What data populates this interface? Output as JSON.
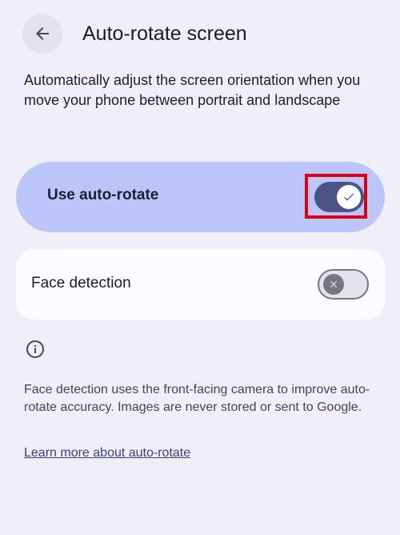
{
  "app_bar": {
    "back_icon": "arrow-back-icon",
    "title": "Auto-rotate screen"
  },
  "description": "Automatically adjust the screen orientation when you move your phone between portrait and landscape",
  "settings": {
    "auto_rotate": {
      "label": "Use auto-rotate",
      "enabled": true,
      "icon": "check-icon"
    },
    "face_detection": {
      "label": "Face detection",
      "enabled": false,
      "icon": "close-icon"
    }
  },
  "footer": {
    "info_icon": "info-icon",
    "text": "Face detection uses the front-facing camera to improve auto-rotate accuracy. Images are never stored or sent to Google.",
    "link": "Learn more about auto-rotate"
  },
  "colors": {
    "background": "#f0eef8",
    "primary_row": "#bcc5f9",
    "toggle_on_track": "#4a5485",
    "highlight": "#e0000b",
    "link": "#3b4279"
  }
}
